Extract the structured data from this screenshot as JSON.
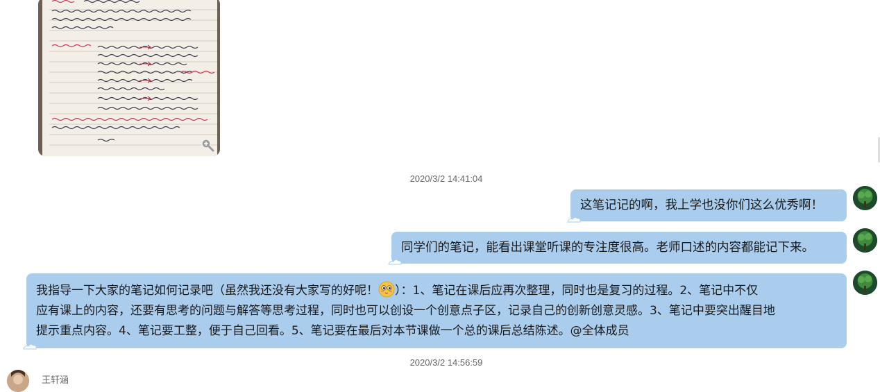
{
  "image_message": {
    "alt_icon": "magnify-plus-icon"
  },
  "timestamps": [
    "2020/3/2 14:41:04",
    "2020/3/2 14:56:59"
  ],
  "messages": [
    {
      "text": "这笔记记的啊，我上学也没你们这么优秀啊！"
    },
    {
      "text": "同学们的笔记，能看出课堂听课的专注度很高。老师口述的内容都能记下来。"
    },
    {
      "text_before_emoji": "我指导一下大家的笔记如何记录吧（虽然我还没有大家写的好呢！",
      "emoji": "blushing-face-icon",
      "text_after_emoji_line1": "）：1、笔记在课后应再次整理，同时也是复习的过程。2、笔记中不仅",
      "line2": "应有课上的内容，还要有思考的问题与解答等思考过程，同时也可以创设一个创意点子区，记录自己的创新创意灵感。3、笔记中要突出醒目地",
      "line3": "提示重点内容。4、笔记要工整，便于自己回看。5、笔记要在最后对本节课做一个总的课后总结陈述。@全体成员"
    }
  ],
  "next_sender": {
    "name": "王轩涵"
  },
  "colors": {
    "bubble": "#aacdee",
    "avatar": "#1d4a2a",
    "timestamp": "#666666"
  }
}
